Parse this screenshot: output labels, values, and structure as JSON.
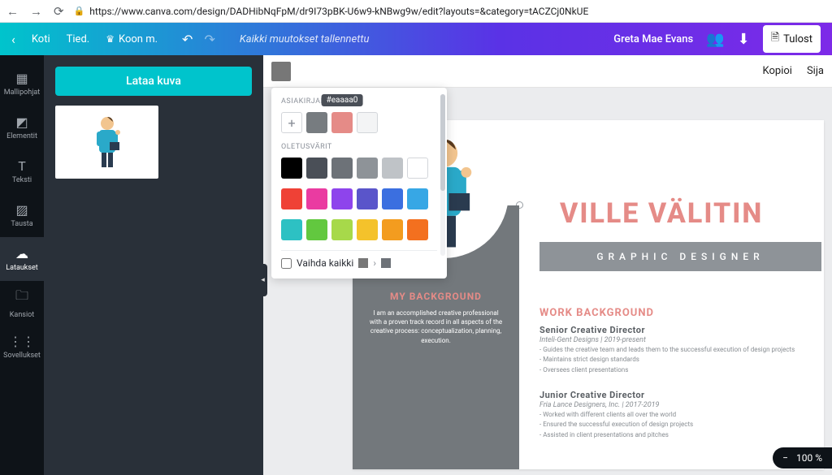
{
  "browser": {
    "url": "https://www.canva.com/design/DADHibNqFpM/dr9I73pBK-U6w9-kNBwg9w/edit?layouts=&category=tACZCj0NkUE"
  },
  "topbar": {
    "home": "Koti",
    "file": "Tied.",
    "resize": "Koon m.",
    "saved": "Kaikki muutokset tallennettu",
    "user": "Greta Mae Evans",
    "print": "Tulost"
  },
  "rail": {
    "templates": "Mallipohjat",
    "elements": "Elementit",
    "text": "Teksti",
    "background": "Tausta",
    "uploads": "Lataukset",
    "folders": "Kansiot",
    "apps": "Sovellukset"
  },
  "panel": {
    "upload": "Lataa kuva"
  },
  "contextbar": {
    "copy": "Kopioi",
    "position": "Sija"
  },
  "colorpop": {
    "doc_label": "ASIAKIRJAN VÄRIT",
    "default_label": "OLETUSVÄRIT",
    "hex_tooltip": "#eaaaa0",
    "change_all": "Vaihda kaikki",
    "doc_swatches": [
      "#777c80",
      "#e58b87",
      "#f3f4f5"
    ],
    "default_rows": [
      [
        "#000000",
        "#4a4f57",
        "#6d7278",
        "#8e9398",
        "#bfc3c7",
        "#ffffff"
      ],
      [
        "#ef4136",
        "#ea3ba1",
        "#8e44ec",
        "#5a55ca",
        "#3b6fe0",
        "#37a7e5"
      ],
      [
        "#2dc1c3",
        "#62c83f",
        "#a7d94a",
        "#f4c22b",
        "#f39c1f",
        "#f3701f"
      ]
    ]
  },
  "doc": {
    "name": "VILLE VÄLITIN",
    "role": "GRAPHIC DESIGNER",
    "bg_title": "MY BACKGROUND",
    "bg_text": "I am an accomplished creative professional with a proven track record in all aspects of the creative process: conceptualization, planning, execution.",
    "work_h": "WORK BACKGROUND",
    "job1": {
      "title": "Senior Creative Director",
      "meta": "Inteli-Gent Designs | 2019-present",
      "l1": "- Guides the creative team and leads them to the successful execution of design projects",
      "l2": "- Maintains strict design standards",
      "l3": "- Oversees client presentations"
    },
    "job2": {
      "title": "Junior Creative Director",
      "meta": "Fria Lance Designers, Inc. | 2017-2019",
      "l1": "- Worked with different clients all over the world",
      "l2": "- Ensured the successful execution of design projects",
      "l3": "- Assisted in client presentations and pitches"
    }
  },
  "zoom": {
    "level": "100 %"
  }
}
